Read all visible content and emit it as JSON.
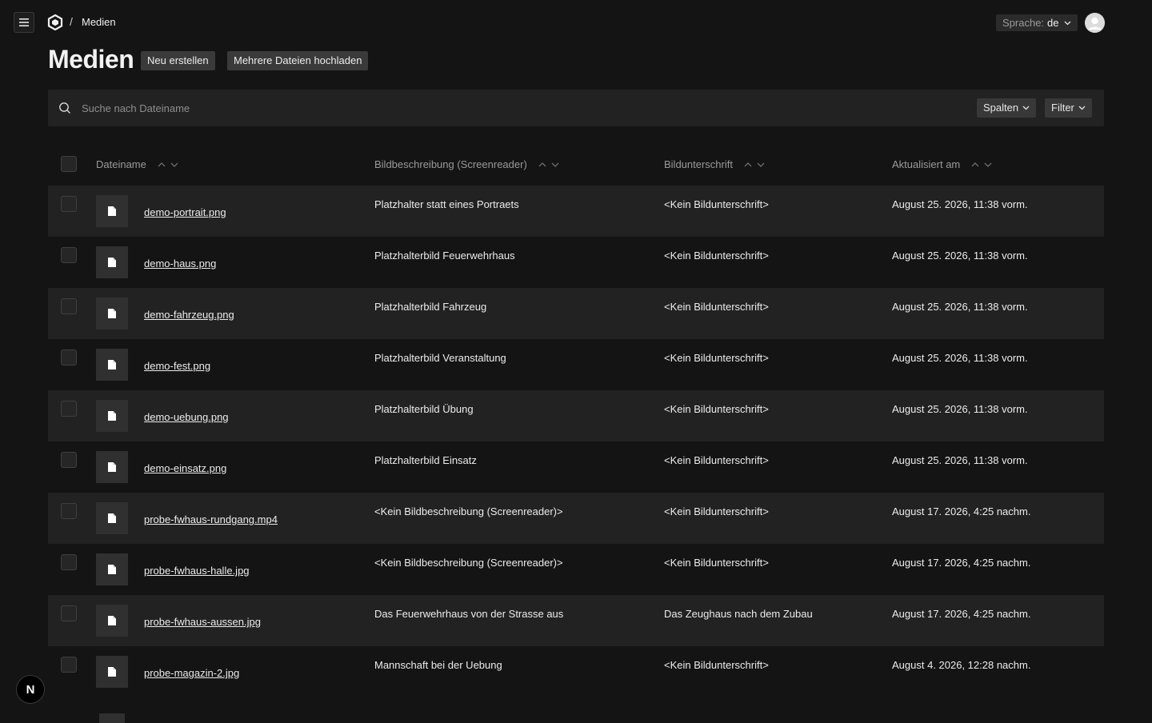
{
  "header": {
    "breadcrumb_separator": "/",
    "breadcrumb_current": "Medien",
    "language": {
      "label": "Sprache:",
      "value": "de"
    },
    "icons": {
      "menu": "hamburger-menu-icon",
      "logo": "hexagon-logo-icon",
      "avatar": "user-avatar-icon"
    }
  },
  "page": {
    "title": "Medien",
    "create_label": "Neu erstellen",
    "bulk_upload_label": "Mehrere Dateien hochladen"
  },
  "search": {
    "placeholder": "Suche nach Dateiname",
    "columns_label": "Spalten",
    "filter_label": "Filter"
  },
  "table": {
    "columns": {
      "filename": "Dateiname",
      "alt": "Bildbeschreibung (Screenreader)",
      "caption": "Bildunterschrift",
      "updated": "Aktualisiert am"
    },
    "rows": [
      {
        "filename": "demo-portrait.png",
        "alt": "Platzhalter statt eines Portraets",
        "caption": "<Kein Bildunterschrift>",
        "updated": "August 25. 2026, 11:38 vorm."
      },
      {
        "filename": "demo-haus.png",
        "alt": "Platzhalterbild Feuerwehrhaus",
        "caption": "<Kein Bildunterschrift>",
        "updated": "August 25. 2026, 11:38 vorm."
      },
      {
        "filename": "demo-fahrzeug.png",
        "alt": "Platzhalterbild Fahrzeug",
        "caption": "<Kein Bildunterschrift>",
        "updated": "August 25. 2026, 11:38 vorm."
      },
      {
        "filename": "demo-fest.png",
        "alt": "Platzhalterbild Veranstaltung",
        "caption": "<Kein Bildunterschrift>",
        "updated": "August 25. 2026, 11:38 vorm."
      },
      {
        "filename": "demo-uebung.png",
        "alt": "Platzhalterbild Übung",
        "caption": "<Kein Bildunterschrift>",
        "updated": "August 25. 2026, 11:38 vorm."
      },
      {
        "filename": "demo-einsatz.png",
        "alt": "Platzhalterbild Einsatz",
        "caption": "<Kein Bildunterschrift>",
        "updated": "August 25. 2026, 11:38 vorm."
      },
      {
        "filename": "probe-fwhaus-rundgang.mp4",
        "alt": "<Kein Bildbeschreibung (Screenreader)>",
        "caption": "<Kein Bildunterschrift>",
        "updated": "August 17. 2026, 4:25 nachm."
      },
      {
        "filename": "probe-fwhaus-halle.jpg",
        "alt": "<Kein Bildbeschreibung (Screenreader)>",
        "caption": "<Kein Bildunterschrift>",
        "updated": "August 17. 2026, 4:25 nachm."
      },
      {
        "filename": "probe-fwhaus-aussen.jpg",
        "alt": "Das Feuerwehrhaus von der Strasse aus",
        "caption": "Das Zeughaus nach dem Zubau",
        "updated": "August 17. 2026, 4:25 nachm."
      },
      {
        "filename": "probe-magazin-2.jpg",
        "alt": "Mannschaft bei der Uebung",
        "caption": "<Kein Bildunterschrift>",
        "updated": "August 4. 2026, 12:28 nachm."
      }
    ]
  },
  "dev_badge": {
    "letter": "N"
  },
  "colors": {
    "background": "#141414",
    "row_alt": "#222222",
    "button": "#3a3a3a",
    "text": "#ececec",
    "muted": "#9a9a9a"
  }
}
